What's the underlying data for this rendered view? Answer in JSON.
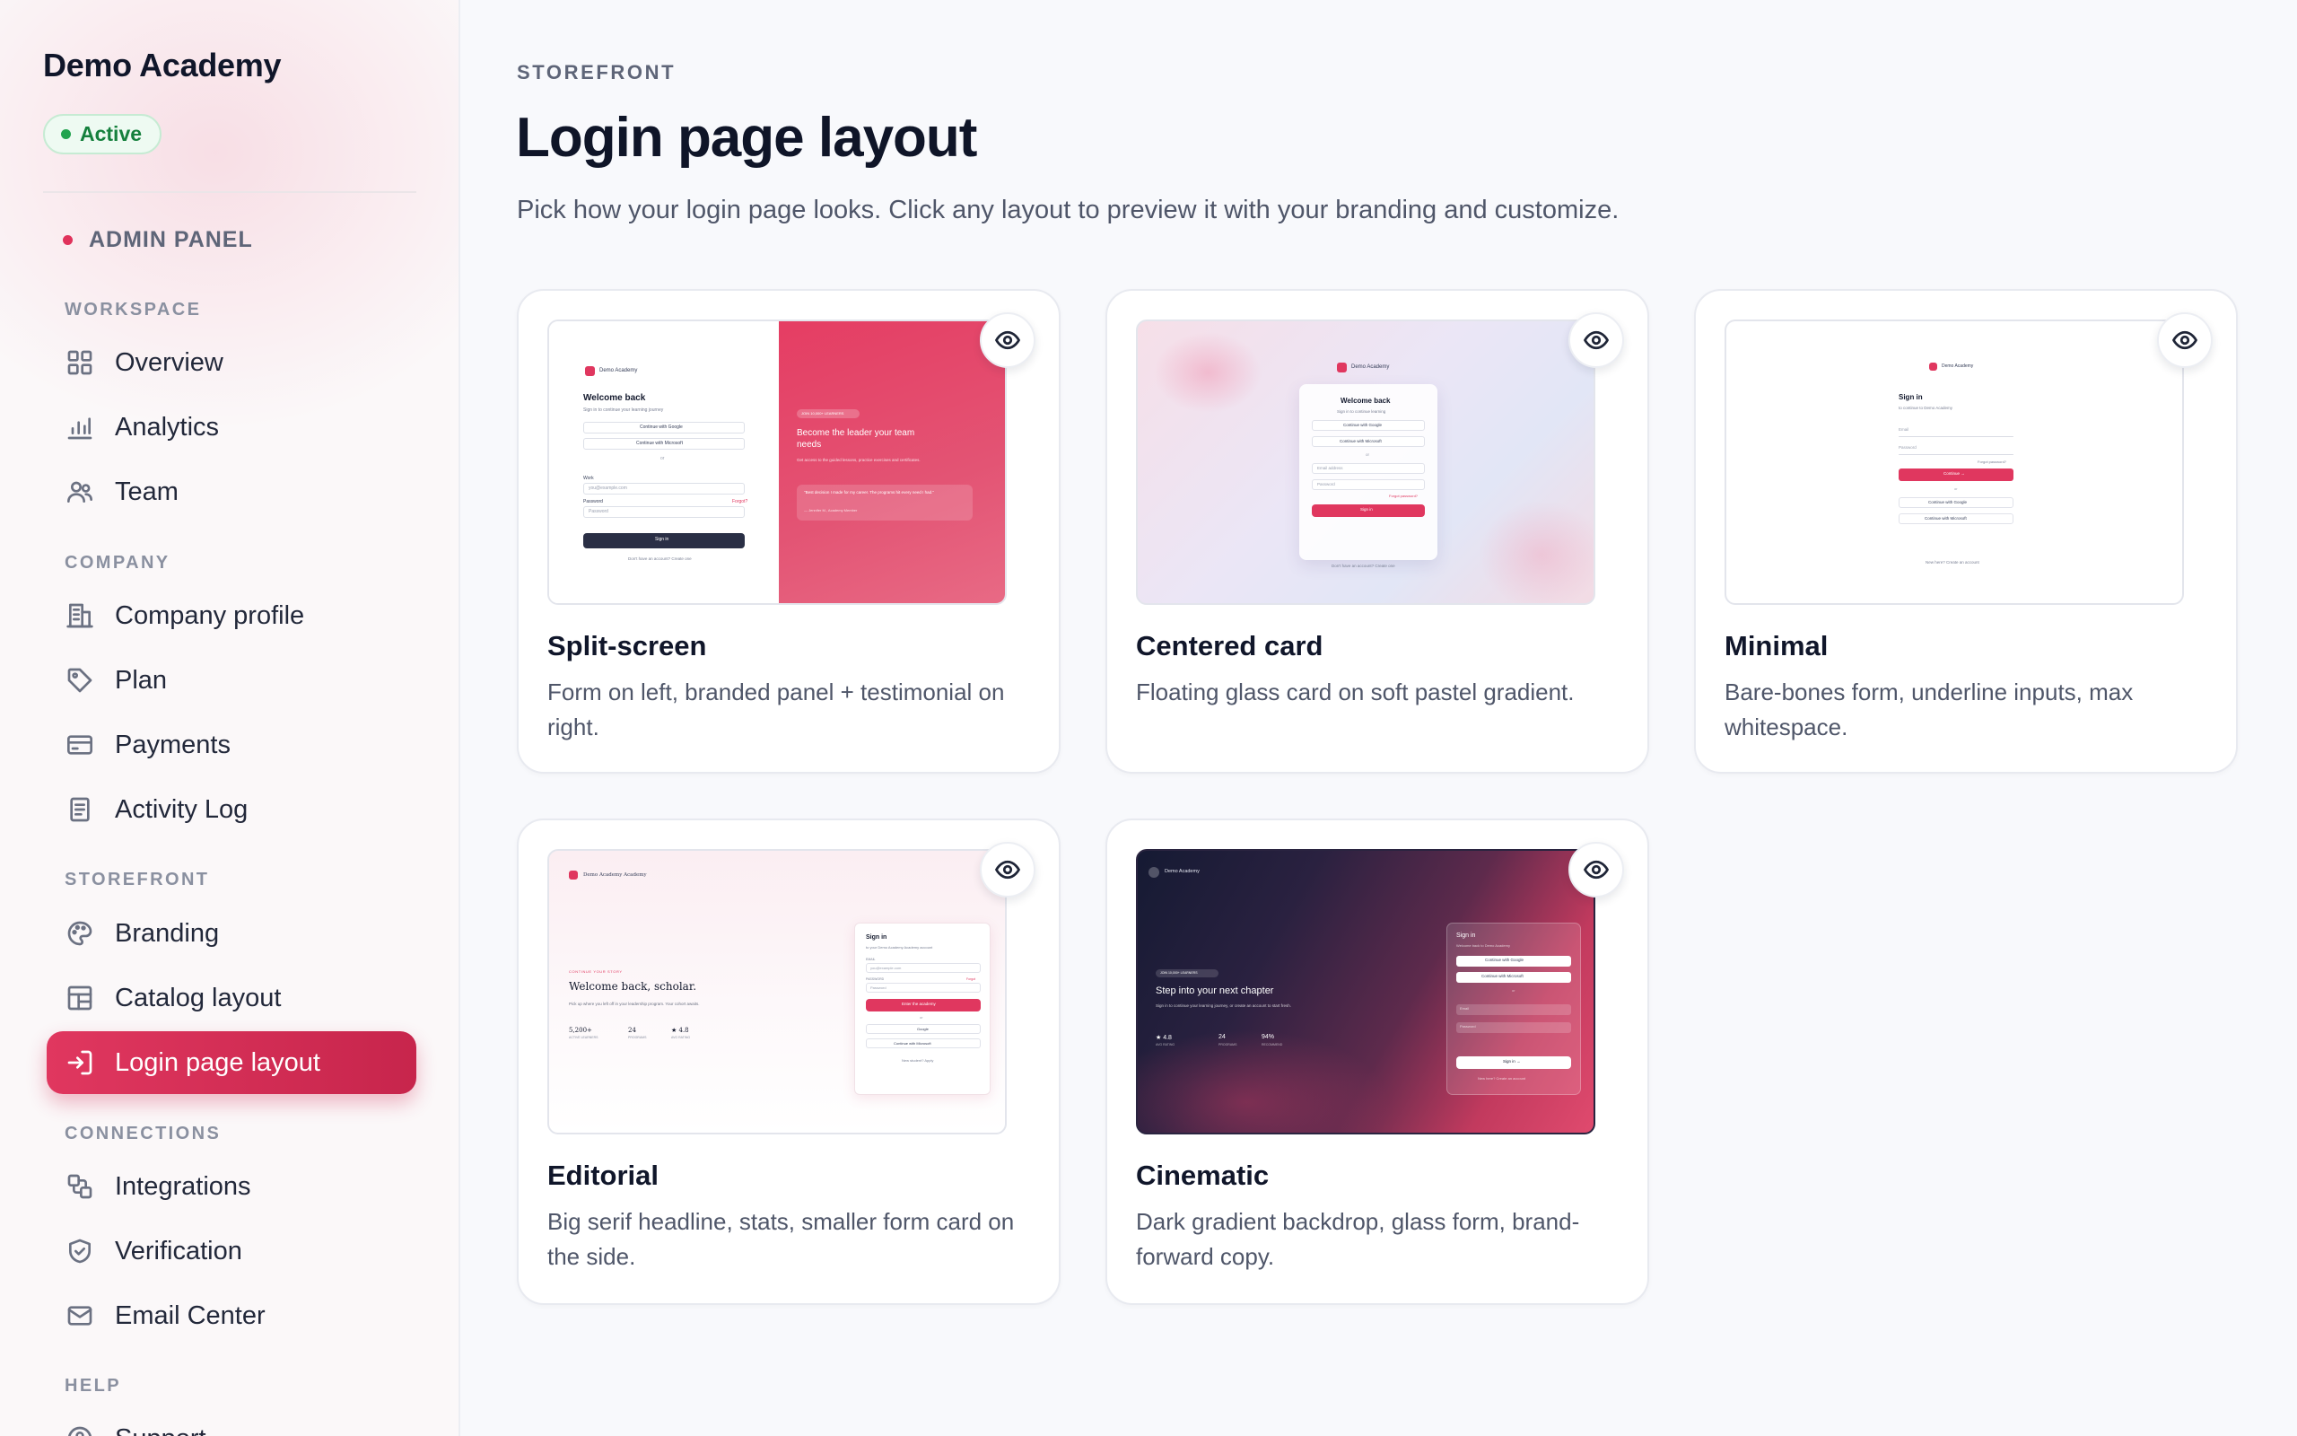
{
  "sidebar": {
    "brand": "Demo Academy",
    "status": "Active",
    "admin_label": "ADMIN PANEL",
    "sections": {
      "workspace": "WORKSPACE",
      "company": "COMPANY",
      "storefront": "STOREFRONT",
      "connections": "CONNECTIONS",
      "help": "HELP"
    },
    "items": {
      "overview": "Overview",
      "analytics": "Analytics",
      "team": "Team",
      "company_profile": "Company profile",
      "plan": "Plan",
      "payments": "Payments",
      "activity_log": "Activity Log",
      "branding": "Branding",
      "catalog_layout": "Catalog layout",
      "login_page_layout": "Login page layout",
      "integrations": "Integrations",
      "verification": "Verification",
      "email_center": "Email Center",
      "support": "Support"
    }
  },
  "main": {
    "eyebrow": "STOREFRONT",
    "title": "Login page layout",
    "description": "Pick how your login page looks. Click any layout to preview it with your branding and customize."
  },
  "layouts": [
    {
      "title": "Split-screen",
      "description": "Form on left, branded panel + testimonial on right.",
      "preview_icon": "eye-icon"
    },
    {
      "title": "Centered card",
      "description": "Floating glass card on soft pastel gradient.",
      "preview_icon": "eye-icon"
    },
    {
      "title": "Minimal",
      "description": "Bare-bones form, underline inputs, max whitespace.",
      "preview_icon": "eye-icon"
    },
    {
      "title": "Editorial",
      "description": "Big serif headline, stats, smaller form card on the side.",
      "preview_icon": "eye-icon"
    },
    {
      "title": "Cinematic",
      "description": "Dark gradient backdrop, glass form, brand-forward copy.",
      "preview_icon": "eye-icon"
    }
  ],
  "previews": {
    "split": {
      "brand": "Demo Academy",
      "heading": "Welcome back",
      "sub": "Sign in to continue your learning journey",
      "google": "Continue with Google",
      "microsoft": "Continue with Microsoft",
      "or": "or",
      "email_label": "Work",
      "email_placeholder": "you@example.com",
      "password_label": "Password",
      "forgot": "Forgot?",
      "password_placeholder": "Password",
      "submit": "Sign in",
      "footer": "Don't have an account? Create one",
      "badge": "JOIN 10,000+ LEARNERS",
      "panel_heading": "Become the leader your team needs",
      "panel_body": "Get access to the guided lessons, practice exercises and certificates.",
      "quote": "\"Best decision I made for my career. The programs hit every need I had.\"",
      "quote_author": "— Jennifer M., Academy Member"
    },
    "centered": {
      "brand": "Demo Academy",
      "heading": "Welcome back",
      "sub": "Sign in to continue learning",
      "google": "Continue with Google",
      "microsoft": "Continue with Microsoft",
      "or": "or",
      "email": "Email address",
      "password": "Password",
      "forgot": "Forgot password?",
      "submit": "Sign in",
      "footer": "Don't have an account? Create one"
    },
    "minimal": {
      "brand": "Demo Academy",
      "heading": "Sign in",
      "sub": "to continue to Demo Academy",
      "email": "Email",
      "password": "Password",
      "forgot": "Forgot password?",
      "submit": "Continue →",
      "or": "or",
      "google": "Continue with Google",
      "microsoft": "Continue with Microsoft",
      "footer": "New here? Create an account"
    },
    "editorial": {
      "brand": "Demo Academy Academy",
      "kicker": "CONTINUE YOUR STORY",
      "headline": "Welcome back, scholar.",
      "body": "Pick up where you left off in your leadership program. Your cohort awaits.",
      "stats": [
        {
          "value": "5,200+",
          "label": "ACTIVE LEARNERS"
        },
        {
          "value": "24",
          "label": "PROGRAMS"
        },
        {
          "value": "★ 4.8",
          "label": "AVG RATING"
        }
      ],
      "form_heading": "Sign in",
      "form_sub": "to your Demo Academy Academy account",
      "email_label": "EMAIL",
      "email_placeholder": "you@example.com",
      "password_label": "PASSWORD",
      "forgot": "Forgot",
      "password_placeholder": "Password",
      "submit": "Enter the academy",
      "or": "or",
      "google": "Google",
      "microsoft": "Continue with Microsoft",
      "footer": "New student? Apply"
    },
    "cinematic": {
      "brand": "Demo Academy",
      "badge": "JOIN 10,000+ LEARNERS",
      "headline": "Step into your next chapter",
      "body": "Sign in to continue your learning journey, or create an account to start fresh.",
      "stats": [
        {
          "value": "★ 4.8",
          "label": "AVG RATING"
        },
        {
          "value": "24",
          "label": "PROGRAMS"
        },
        {
          "value": "94%",
          "label": "RECOMMEND"
        }
      ],
      "form_heading": "Sign in",
      "form_sub": "Welcome back to Demo Academy",
      "google": "Continue with Google",
      "microsoft": "Continue with Microsoft",
      "or": "or",
      "email": "Email",
      "password": "Password",
      "submit": "Sign in →",
      "footer": "New here? Create an account"
    }
  }
}
